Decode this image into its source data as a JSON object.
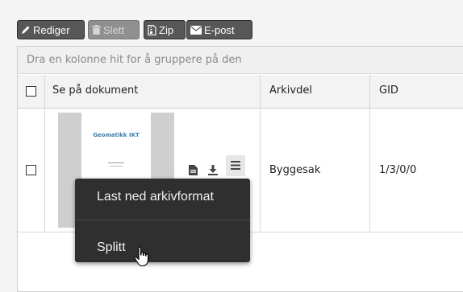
{
  "toolbar": {
    "rediger_label": "Rediger",
    "slett_label": "Slett",
    "zip_label": "Zip",
    "epost_label": "E-post"
  },
  "grid": {
    "group_hint": "Dra en kolonne hit for å gruppere på den",
    "columns": [
      "Se på dokument",
      "Arkivdel",
      "GID"
    ],
    "rows": [
      {
        "arkivdel": "Byggesak",
        "gid": "1/3/0/0"
      }
    ]
  },
  "thumbnail": {
    "logo_text": "Geomatikk IKT"
  },
  "context_menu": {
    "items": [
      "Last ned arkivformat",
      "Splitt"
    ]
  },
  "icons": {
    "rediger": "pencil-icon",
    "slett": "trash-icon",
    "zip": "file-archive-icon",
    "epost": "envelope-icon",
    "row_actions": [
      "file-icon",
      "download-icon",
      "hamburger-menu-icon"
    ],
    "cursor": "hand-pointer-icon"
  },
  "colors": {
    "toolbar_button": "#575757",
    "disabled_button": "#909090",
    "context_menu": "#2f2f2f"
  }
}
